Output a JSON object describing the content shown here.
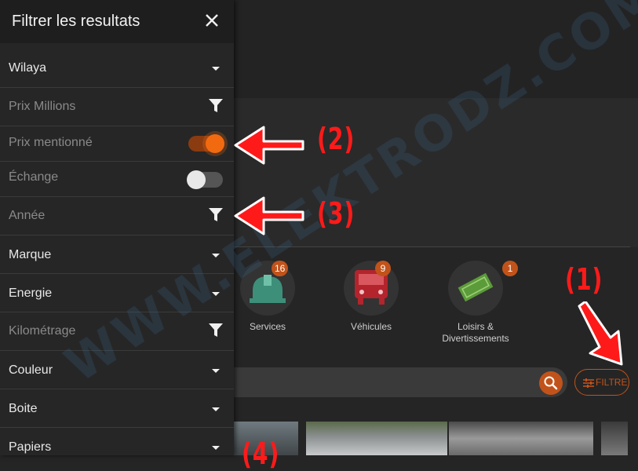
{
  "drawer": {
    "title": "Filtrer les resultats",
    "rows": [
      {
        "label": "Wilaya",
        "control": "chevron-down"
      },
      {
        "label": "Prix Millions",
        "control": "funnel"
      },
      {
        "label": "Prix mentionné",
        "control": "toggle",
        "on": true
      },
      {
        "label": "Échange",
        "control": "toggle",
        "on": false
      },
      {
        "label": "Année",
        "control": "funnel"
      },
      {
        "label": "Marque",
        "control": "chevron-down"
      },
      {
        "label": "Energie",
        "control": "chevron-down"
      },
      {
        "label": "Kilométrage",
        "control": "funnel"
      },
      {
        "label": "Couleur",
        "control": "chevron-down"
      },
      {
        "label": "Boite",
        "control": "chevron-down"
      },
      {
        "label": "Papiers",
        "control": "chevron-down"
      }
    ]
  },
  "categories": [
    {
      "label": "Services",
      "count": "16",
      "icon": "helmet-icon",
      "color": "#3d8f7a"
    },
    {
      "label": "Véhicules",
      "count": "9",
      "icon": "bus-icon",
      "color": "#b3242c"
    },
    {
      "label": "Loisirs &",
      "label2": "Divertissements",
      "count": "1",
      "icon": "tickets-icon",
      "color": "#5c9b3a"
    }
  ],
  "search": {
    "filter_label": "FILTRE"
  },
  "annotations": {
    "a1": "(1)",
    "a2": "(2)",
    "a3": "(3)",
    "a4": "(4)"
  },
  "watermark": "WWW.ELEKTRODZ.COM",
  "colors": {
    "accent": "#c1531a",
    "toggle_on": "#f26a10",
    "arrow": "#ff1a1a"
  }
}
